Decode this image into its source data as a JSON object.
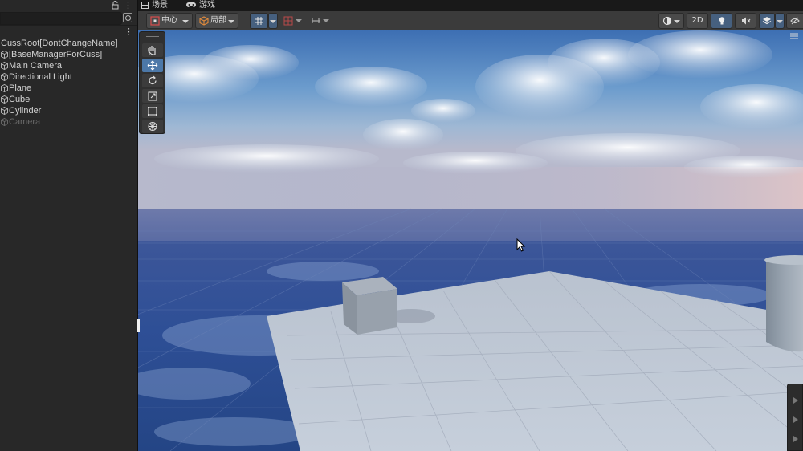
{
  "hierarchy": {
    "items": [
      {
        "label": "CussRoot[DontChangeName]",
        "kind": "root",
        "enabled": true
      },
      {
        "label": "[BaseManagerForCuss]",
        "kind": "object",
        "enabled": true
      },
      {
        "label": "Main Camera",
        "kind": "object",
        "enabled": true
      },
      {
        "label": "Directional Light",
        "kind": "object",
        "enabled": true
      },
      {
        "label": "Plane",
        "kind": "object",
        "enabled": true
      },
      {
        "label": "Cube",
        "kind": "object",
        "enabled": true
      },
      {
        "label": "Cylinder",
        "kind": "object",
        "enabled": true
      },
      {
        "label": "Camera",
        "kind": "object",
        "enabled": false
      }
    ]
  },
  "tabs": {
    "scene": "场景",
    "game": "游戏"
  },
  "toolbar": {
    "pivot_label": "中心",
    "space_label": "局部",
    "mode_2d": "2D"
  },
  "colors": {
    "accent": "#4c78a8",
    "panel": "#282828",
    "toolbar": "#3b3b3b"
  },
  "tools": [
    "hand-tool",
    "move-tool",
    "rotate-tool",
    "scale-tool",
    "rect-tool",
    "transform-tool"
  ],
  "active_tool": "move-tool"
}
